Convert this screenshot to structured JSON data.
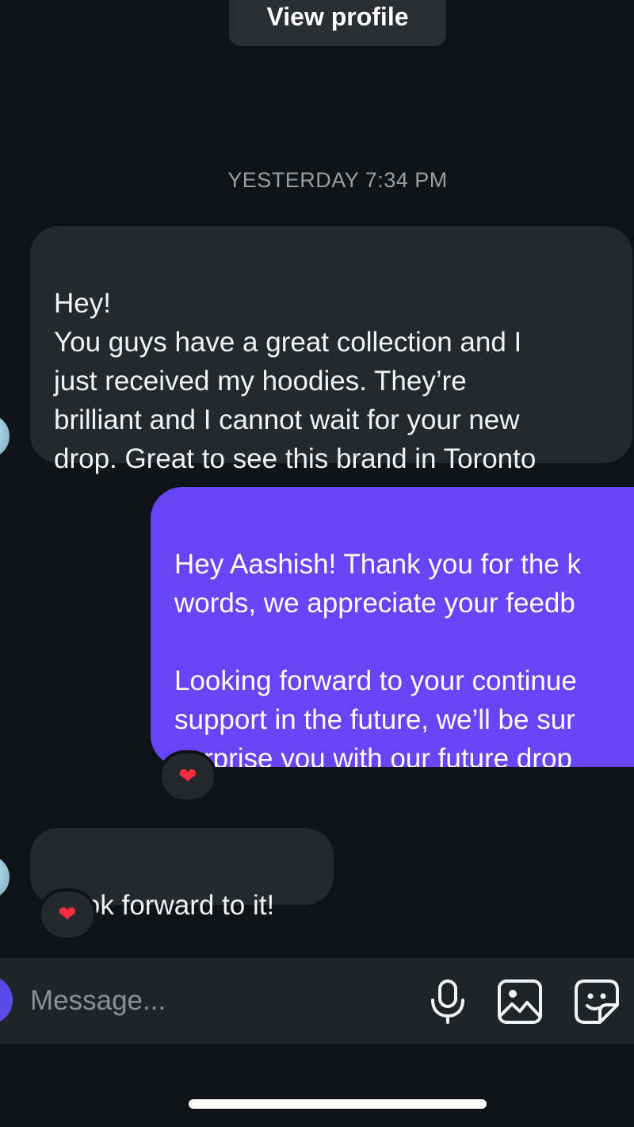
{
  "header": {
    "view_profile_label": "View profile"
  },
  "timestamp": "YESTERDAY 7:34 PM",
  "messages": [
    {
      "direction": "incoming",
      "text": "Hey!\nYou guys have a great collection and I\njust received my hoodies. They’re\nbrilliant and I cannot wait for your new\ndrop. Great to see this brand in Toronto"
    },
    {
      "direction": "outgoing",
      "text": "Hey Aashish! Thank you for the k\nwords, we appreciate your feedb\n\nLooking forward to your continue\nsupport in the future, we’ll be sur\nsurprise you with our future drop",
      "reaction": "❤"
    },
    {
      "direction": "incoming",
      "text": "Look forward to it!",
      "reaction": "❤"
    }
  ],
  "composer": {
    "placeholder": "Message...",
    "icons": [
      "microphone-icon",
      "gallery-icon",
      "sticker-icon"
    ]
  },
  "colors": {
    "background": "#0f1216",
    "incoming_bubble": "#25282e",
    "outgoing_bubble": "#6545f5",
    "reaction_heart": "#ff2d3d"
  }
}
